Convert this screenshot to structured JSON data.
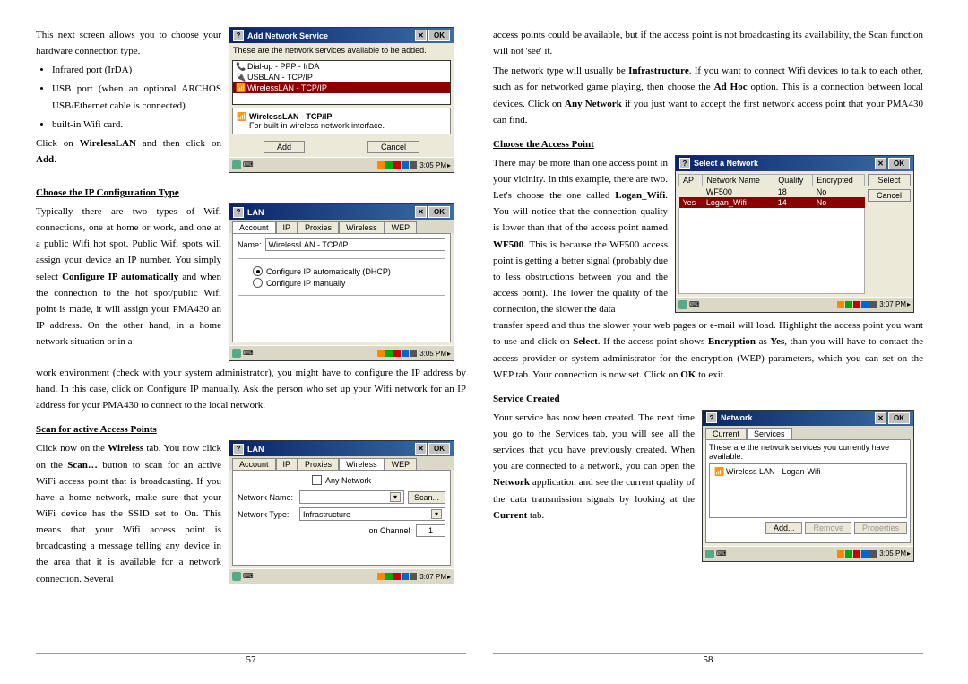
{
  "page_numbers": {
    "left": "57",
    "right": "58"
  },
  "left_page": {
    "intro": "This next screen allows you to choose your hardware connection type.",
    "bullets": [
      "Infrared port (IrDA)",
      "USB port (when an optional ARCHOS USB/Ethernet cable is connected)",
      "built-in Wifi card."
    ],
    "after_bullets_1": "Click on ",
    "after_bullets_b1": "WirelessLAN",
    "after_bullets_2": " and then click on ",
    "after_bullets_b2": "Add",
    "after_bullets_3": ".",
    "h_ipconfig": "Choose the IP Configuration Type",
    "ipconfig_p1_a": "Typically there are two types of Wifi connections, one at home or work, and one at a public Wifi hot spot. Public Wifi spots will assign your device an IP number. You simply select ",
    "ipconfig_p1_b": "Configure IP automatically",
    "ipconfig_p1_c": " and when the connection to the hot spot/public Wifi point is made, it will assign your PMA430 an IP address. On the other hand, in a home network situation or in a",
    "ipconfig_p2": "work environment (check with your system administrator), you might have to configure the IP address by hand. In this case, click on Configure IP manually. Ask the person who set up your Wifi network for an IP address for your PMA430 to connect to the local network.",
    "h_scan": "Scan for active Access Points",
    "scan_p_a": "Click now on the ",
    "scan_p_b1": "Wireless",
    "scan_p_c": " tab. You now click on the ",
    "scan_p_b2": "Scan…",
    "scan_p_d": " button to scan for an active WiFi access point that is broadcasting. If you have a home network, make sure that your WiFi device has the SSID set to On.  This means that your Wifi access point is broadcasting a message telling any device in the area that it is available for a network connection. Several"
  },
  "right_page": {
    "top_a": "access points could be available, but if the access point is not broadcasting its availability, the Scan function will not 'see' it.",
    "top_b1": "The network type will usually be ",
    "top_b2": "Infrastructure",
    "top_b3": ". If you want to connect Wifi devices to talk to each other, such as for networked game playing, then choose the ",
    "top_b4": "Ad Hoc",
    "top_b5": " option.  This is a connection between local devices. Click on ",
    "top_b6": "Any Network",
    "top_b7": " if you just want to accept the first network access point that your PMA430 can find.",
    "h_choose": "Choose the Access Point",
    "choose_p1_a": "There may be more than one access point in your vicinity.  In this example, there are two. Let's choose the one called ",
    "choose_p1_b": "Logan_Wifi",
    "choose_p1_c": ".  You will notice that the connection quality is lower than that of the access point named ",
    "choose_p1_d": "WF500",
    "choose_p1_e": ".   This is because the WF500 access point is getting a better signal (probably due to less obstructions between you and the access point). The lower the quality of the connection, the slower the data",
    "choose_p2_a": "transfer speed and thus the slower your web pages or e-mail will load. Highlight the access point you want to use and click on ",
    "choose_p2_b": "Select",
    "choose_p2_c": ". If the access point shows ",
    "choose_p2_d": "Encryption",
    "choose_p2_e": " as ",
    "choose_p2_f": "Yes",
    "choose_p2_g": ", than you will have to contact the access provider or system administrator for the encryption (WEP) parameters, which you can set on the WEP tab. Your connection is now set. Click on ",
    "choose_p2_h": "OK",
    "choose_p2_i": " to exit.",
    "h_service": "Service Created",
    "service_p_a": "Your service has now been created.  The next time you go to the Services tab, you will see all the services that you have previously created. When you are connected to a network, you can open the ",
    "service_p_b": "Network",
    "service_p_c": " application and see the current quality of the data transmission signals by looking at the ",
    "service_p_d": "Current",
    "service_p_e": " tab."
  },
  "dlg_add_network": {
    "title": "Add Network Service",
    "desc": "These are the network services available to be added.",
    "items": [
      {
        "icon": "modem",
        "label": "Dial-up - PPP - IrDA"
      },
      {
        "icon": "usb",
        "label": "USBLAN - TCP/IP"
      },
      {
        "icon": "wifi",
        "label": "WirelessLAN - TCP/IP"
      }
    ],
    "detail_title": "WirelessLAN - TCP/IP",
    "detail_desc": "For built-in wireless network interface.",
    "btn_add": "Add",
    "btn_cancel": "Cancel",
    "time": "3:05 PM"
  },
  "dlg_lan1": {
    "title": "LAN",
    "tabs": [
      "Account",
      "IP",
      "Proxies",
      "Wireless",
      "WEP"
    ],
    "active_tab": 0,
    "name_label": "Name:",
    "name_value": "WirelessLAN - TCP/IP",
    "radio1": "Configure IP automatically (DHCP)",
    "radio2": "Configure IP manually",
    "time": "3:05 PM"
  },
  "dlg_lan2": {
    "title": "LAN",
    "tabs": [
      "Account",
      "IP",
      "Proxies",
      "Wireless",
      "WEP"
    ],
    "active_tab": 3,
    "any_network": "Any Network",
    "nn_label": "Network Name:",
    "nn_value": "",
    "nt_label": "Network Type:",
    "nt_value": "Infrastructure",
    "ch_label": "on Channel:",
    "ch_value": "1",
    "scan_btn": "Scan...",
    "time": "3:07 PM"
  },
  "dlg_select_network": {
    "title": "Select a Network",
    "cols": [
      "AP",
      "Network Name",
      "Quality",
      "Encrypted"
    ],
    "rows": [
      {
        "ap": "",
        "name": "WF500",
        "quality": "18",
        "enc": "No",
        "sel": false
      },
      {
        "ap": "Yes",
        "name": "Logan_Wifi",
        "quality": "14",
        "enc": "No",
        "sel": true
      }
    ],
    "btn_select": "Select",
    "btn_cancel": "Cancel",
    "time": "3:07 PM"
  },
  "dlg_network": {
    "title": "Network",
    "tabs": [
      "Current",
      "Services"
    ],
    "active_tab": 1,
    "desc": "These are the network services you currently have available.",
    "items": [
      {
        "icon": "wifi",
        "label": "Wireless LAN - Logan-Wifi"
      }
    ],
    "btn_add": "Add...",
    "btn_remove": "Remove",
    "btn_props": "Properties",
    "time": "3:05 PM"
  },
  "ok_label": "OK"
}
